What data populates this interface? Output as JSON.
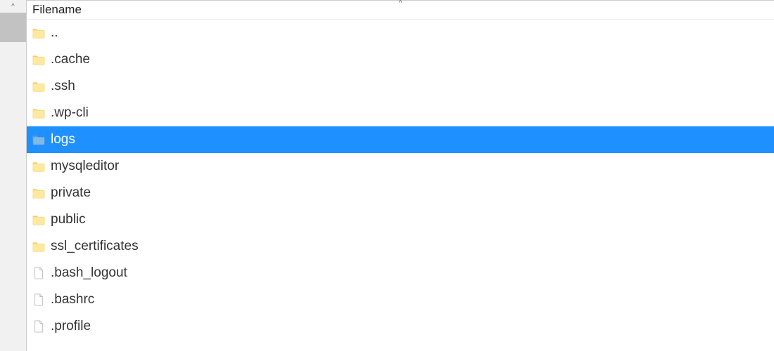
{
  "header": {
    "column_label": "Filename",
    "sort_indicator": "^"
  },
  "left_scroll": {
    "up_label": "^"
  },
  "colors": {
    "selection": "#1e90ff",
    "folder_fill": "#ffe9a2",
    "folder_tab": "#f0d060",
    "file_stroke": "#bdbdbd"
  },
  "items": [
    {
      "name": "..",
      "type": "folder",
      "selected": false
    },
    {
      "name": ".cache",
      "type": "folder",
      "selected": false
    },
    {
      "name": ".ssh",
      "type": "folder",
      "selected": false
    },
    {
      "name": ".wp-cli",
      "type": "folder",
      "selected": false
    },
    {
      "name": "logs",
      "type": "folder",
      "selected": true
    },
    {
      "name": "mysqleditor",
      "type": "folder",
      "selected": false
    },
    {
      "name": "private",
      "type": "folder",
      "selected": false
    },
    {
      "name": "public",
      "type": "folder",
      "selected": false
    },
    {
      "name": "ssl_certificates",
      "type": "folder",
      "selected": false
    },
    {
      "name": ".bash_logout",
      "type": "file",
      "selected": false
    },
    {
      "name": ".bashrc",
      "type": "file",
      "selected": false
    },
    {
      "name": ".profile",
      "type": "file",
      "selected": false
    }
  ]
}
